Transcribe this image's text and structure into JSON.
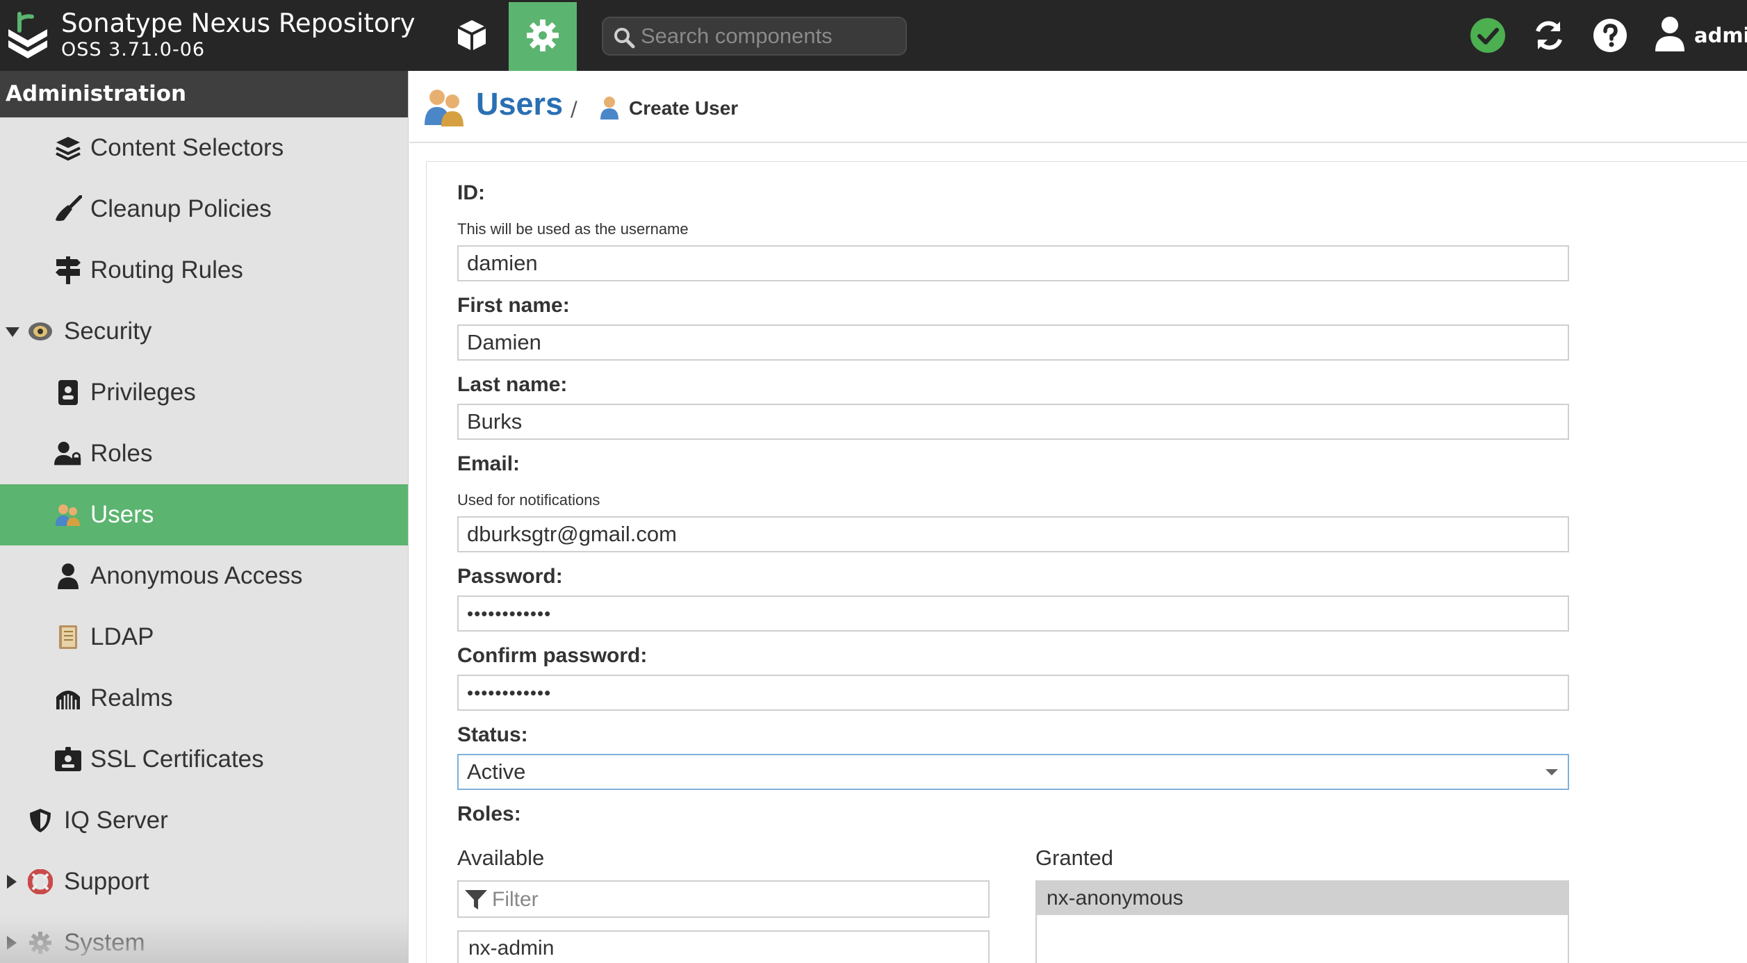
{
  "header": {
    "brand_title": "Sonatype Nexus Repository",
    "brand_version": "OSS 3.71.0-06",
    "search_placeholder": "Search components",
    "user_name": "admin",
    "colors": {
      "bar": "#262626",
      "accent": "#5bb46f",
      "status_ok": "#4caf50"
    }
  },
  "sidebar": {
    "heading": "Administration",
    "items": [
      {
        "label": "Content Selectors",
        "icon": "layers-icon"
      },
      {
        "label": "Cleanup Policies",
        "icon": "broom-icon"
      },
      {
        "label": "Routing Rules",
        "icon": "signpost-icon"
      },
      {
        "label": "Security",
        "icon": "security-badge-icon",
        "expanded": true
      },
      {
        "label": "Privileges",
        "icon": "id-badge-icon"
      },
      {
        "label": "Roles",
        "icon": "user-lock-icon"
      },
      {
        "label": "Users",
        "icon": "users-icon",
        "active": true
      },
      {
        "label": "Anonymous Access",
        "icon": "user-icon"
      },
      {
        "label": "LDAP",
        "icon": "address-book-icon"
      },
      {
        "label": "Realms",
        "icon": "realm-icon"
      },
      {
        "label": "SSL Certificates",
        "icon": "certificate-icon"
      },
      {
        "label": "IQ Server",
        "icon": "shield-icon"
      },
      {
        "label": "Support",
        "icon": "lifebuoy-icon",
        "expanded": false
      },
      {
        "label": "System",
        "icon": "gear-icon",
        "expanded": false
      }
    ]
  },
  "breadcrumb": {
    "section": "Users",
    "separator": "/",
    "page": "Create User"
  },
  "form": {
    "id": {
      "label": "ID:",
      "help": "This will be used as the username",
      "value": "damien"
    },
    "first_name": {
      "label": "First name:",
      "value": "Damien"
    },
    "last_name": {
      "label": "Last name:",
      "value": "Burks"
    },
    "email": {
      "label": "Email:",
      "help": "Used for notifications",
      "value": "dburksgtr@gmail.com"
    },
    "password": {
      "label": "Password:",
      "value": "••••••••••••"
    },
    "confirm_password": {
      "label": "Confirm password:",
      "value": "••••••••••••"
    },
    "status": {
      "label": "Status:",
      "value": "Active"
    },
    "roles": {
      "label": "Roles:",
      "available_label": "Available",
      "granted_label": "Granted",
      "filter_placeholder": "Filter",
      "available": [
        "nx-admin"
      ],
      "granted": [
        "nx-anonymous"
      ]
    }
  }
}
